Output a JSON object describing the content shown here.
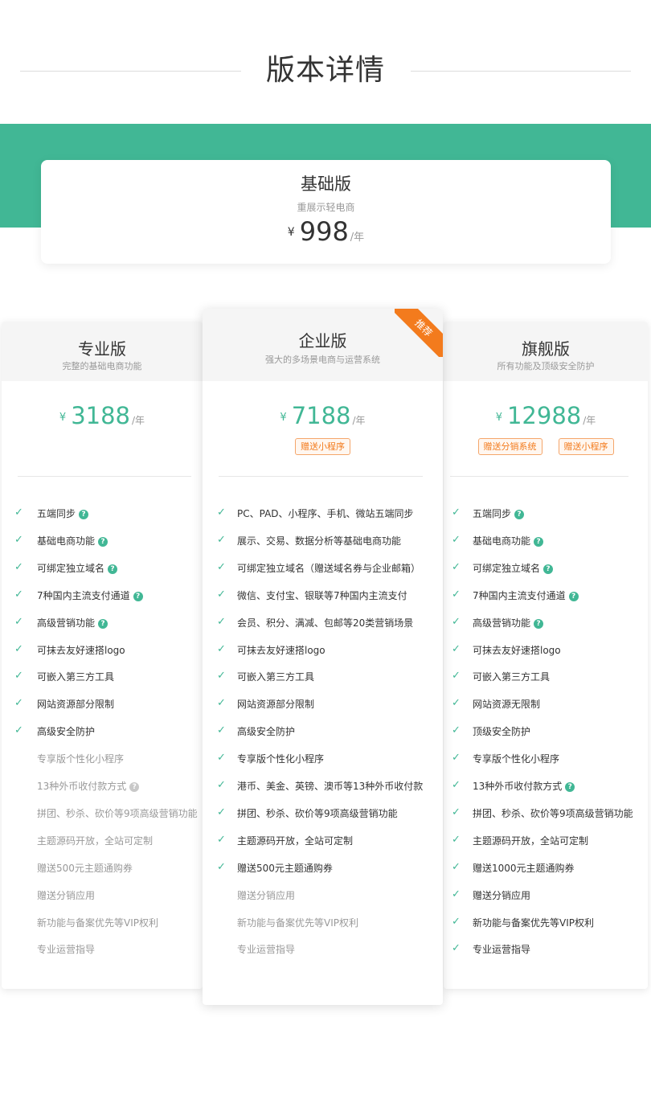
{
  "page_title": "版本详情",
  "colors": {
    "brand_green": "#41b795",
    "accent_orange": "#f37b1d"
  },
  "icons": {
    "check": "check-icon",
    "help": "question-circle-icon"
  },
  "basic": {
    "name": "基础版",
    "subtitle": "重展示轻电商",
    "currency": "¥",
    "price": "998",
    "unit": "/年"
  },
  "plans": [
    {
      "id": "pro",
      "name": "专业版",
      "subtitle": "完整的基础电商功能",
      "currency": "¥",
      "price": "3188",
      "unit": "/年",
      "tags": [],
      "features": [
        {
          "text": "五端同步",
          "on": true,
          "help": true
        },
        {
          "text": "基础电商功能",
          "on": true,
          "help": true
        },
        {
          "text": "可绑定独立域名",
          "on": true,
          "help": true
        },
        {
          "text": "7种国内主流支付通道",
          "on": true,
          "help": true
        },
        {
          "text": "高级营销功能",
          "on": true,
          "help": true
        },
        {
          "text": "可抹去友好速搭logo",
          "on": true,
          "help": false
        },
        {
          "text": "可嵌入第三方工具",
          "on": true,
          "help": false
        },
        {
          "text": "网站资源部分限制",
          "on": true,
          "help": false
        },
        {
          "text": "高级安全防护",
          "on": true,
          "help": false
        },
        {
          "text": "专享版个性化小程序",
          "on": false,
          "help": false
        },
        {
          "text": "13种外币收付款方式",
          "on": false,
          "help": true
        },
        {
          "text": "拼团、秒杀、砍价等9项高级营销功能",
          "on": false,
          "help": false
        },
        {
          "text": "主题源码开放，全站可定制",
          "on": false,
          "help": false
        },
        {
          "text": "赠送500元主题通购券",
          "on": false,
          "help": false
        },
        {
          "text": "赠送分销应用",
          "on": false,
          "help": false
        },
        {
          "text": "新功能与备案优先等VIP权利",
          "on": false,
          "help": false
        },
        {
          "text": "专业运营指导",
          "on": false,
          "help": false
        }
      ]
    },
    {
      "id": "enterprise",
      "name": "企业版",
      "subtitle": "强大的多场景电商与运营系统",
      "badge": "推荐",
      "currency": "¥",
      "price": "7188",
      "unit": "/年",
      "tags": [
        "赠送小程序"
      ],
      "features": [
        {
          "text": "PC、PAD、小程序、手机、微站五端同步",
          "on": true,
          "help": false
        },
        {
          "text": "展示、交易、数据分析等基础电商功能",
          "on": true,
          "help": false
        },
        {
          "text": "可绑定独立域名（赠送域名券与企业邮箱）",
          "on": true,
          "help": false
        },
        {
          "text": "微信、支付宝、银联等7种国内主流支付",
          "on": true,
          "help": false
        },
        {
          "text": "会员、积分、满减、包邮等20类营销场景",
          "on": true,
          "help": false
        },
        {
          "text": "可抹去友好速搭logo",
          "on": true,
          "help": false
        },
        {
          "text": "可嵌入第三方工具",
          "on": true,
          "help": false
        },
        {
          "text": "网站资源部分限制",
          "on": true,
          "help": false
        },
        {
          "text": "高级安全防护",
          "on": true,
          "help": false
        },
        {
          "text": "专享版个性化小程序",
          "on": true,
          "help": false
        },
        {
          "text": "港币、美金、英镑、澳币等13种外币收付款",
          "on": true,
          "help": false
        },
        {
          "text": "拼团、秒杀、砍价等9项高级营销功能",
          "on": true,
          "help": false
        },
        {
          "text": "主题源码开放，全站可定制",
          "on": true,
          "help": false
        },
        {
          "text": "赠送500元主题通购券",
          "on": true,
          "help": false
        },
        {
          "text": "赠送分销应用",
          "on": false,
          "help": false
        },
        {
          "text": "新功能与备案优先等VIP权利",
          "on": false,
          "help": false
        },
        {
          "text": "专业运营指导",
          "on": false,
          "help": false
        }
      ]
    },
    {
      "id": "flagship",
      "name": "旗舰版",
      "subtitle": "所有功能及顶级安全防护",
      "currency": "¥",
      "price": "12988",
      "unit": "/年",
      "tags": [
        "赠送分销系统",
        "赠送小程序"
      ],
      "features": [
        {
          "text": "五端同步",
          "on": true,
          "help": true
        },
        {
          "text": "基础电商功能",
          "on": true,
          "help": true
        },
        {
          "text": "可绑定独立域名",
          "on": true,
          "help": true
        },
        {
          "text": "7种国内主流支付通道",
          "on": true,
          "help": true
        },
        {
          "text": "高级营销功能",
          "on": true,
          "help": true
        },
        {
          "text": "可抹去友好速搭logo",
          "on": true,
          "help": false
        },
        {
          "text": "可嵌入第三方工具",
          "on": true,
          "help": false
        },
        {
          "text": "网站资源无限制",
          "on": true,
          "help": false
        },
        {
          "text": "顶级安全防护",
          "on": true,
          "help": false
        },
        {
          "text": "专享版个性化小程序",
          "on": true,
          "help": false
        },
        {
          "text": "13种外币收付款方式",
          "on": true,
          "help": true
        },
        {
          "text": "拼团、秒杀、砍价等9项高级营销功能",
          "on": true,
          "help": false
        },
        {
          "text": "主题源码开放，全站可定制",
          "on": true,
          "help": false
        },
        {
          "text": "赠送1000元主题通购券",
          "on": true,
          "help": false
        },
        {
          "text": "赠送分销应用",
          "on": true,
          "help": false
        },
        {
          "text": "新功能与备案优先等VIP权利",
          "on": true,
          "help": false
        },
        {
          "text": "专业运营指导",
          "on": true,
          "help": false
        }
      ]
    }
  ]
}
